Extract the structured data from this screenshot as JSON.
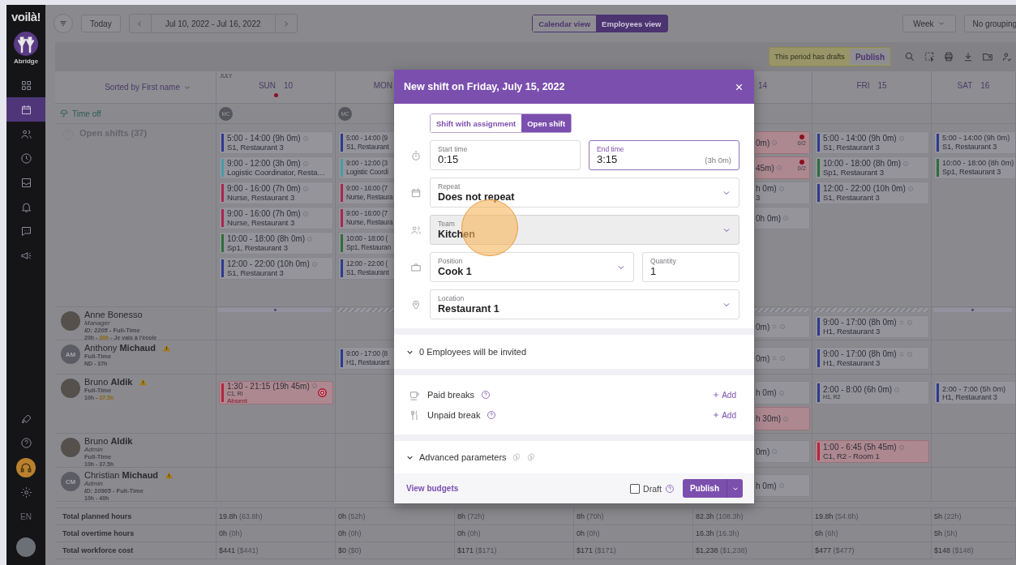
{
  "sidebar": {
    "logo": "voilà!",
    "org": "Abridge",
    "nav": [
      {
        "selected": false
      },
      {
        "selected": true
      },
      {
        "selected": false
      },
      {
        "selected": false
      },
      {
        "selected": false
      },
      {
        "selected": false
      },
      {
        "selected": false
      },
      {
        "selected": false
      }
    ],
    "language": "EN"
  },
  "topbar": {
    "today": "Today",
    "date_range": "Jul 10, 2022 - Jul 16, 2022",
    "views": [
      {
        "label": "Calendar view",
        "selected": false
      },
      {
        "label": "Employees view",
        "selected": true
      }
    ],
    "period": "Week",
    "grouping": "No grouping"
  },
  "toolbar": {
    "drafts_notice": "This period has drafts",
    "publish": "Publish"
  },
  "calendar": {
    "sort": "Sorted by First name",
    "month": "JULY",
    "days": [
      {
        "name": "SUN",
        "date": "10",
        "marker": true
      },
      {
        "name": "MON",
        "marker": false
      },
      {
        "date": "14",
        "marker": false
      },
      {
        "name": "FRI",
        "date": "15",
        "marker": false
      },
      {
        "name": "SAT",
        "date": "16",
        "marker": false
      }
    ]
  },
  "time_off": {
    "label": "Time off",
    "cells": [
      {
        "initials": "MC"
      },
      {
        "initials": "MC"
      },
      {},
      {},
      {},
      {},
      {}
    ]
  },
  "open_shifts": {
    "label": "Open shifts (37)",
    "cells": [
      {
        "cards": [
          {
            "time": "5:00 - 14:00 (9h 0m)",
            "place": "S1, Restaurant 3",
            "color": "#2f3a8c",
            "warning": false
          },
          {
            "time": "9:00 - 12:00 (3h 0m)",
            "place": "Logistic Coordinator, Resta…",
            "color": "#4a9aa6",
            "warning": false
          },
          {
            "time": "9:00 - 16:00 (7h 0m)",
            "place": "Nurse, Restaurant 3",
            "color": "#a8284f",
            "warning": false
          },
          {
            "time": "9:00 - 16:00 (7h 0m)",
            "place": "Nurse, Restaurant 3",
            "color": "#a8284f",
            "warning": false
          },
          {
            "time": "10:00 - 18:00 (8h 0m)",
            "place": "Sp1, Restaurant 3",
            "color": "#2f6e3a",
            "warning": false
          },
          {
            "time": "12:00 - 22:00 (10h 0m)",
            "place": "S1, Restaurant 3",
            "color": "#2f3a8c",
            "warning": false
          }
        ]
      },
      {
        "cards": [
          {
            "time": "5:00 - 14:00 (9",
            "place": "S1, Restaurant",
            "color": "#2f3a8c",
            "warning": false
          },
          {
            "time": "9:00 - 12:00 (3",
            "place": "Logistic Coordi",
            "color": "#4a9aa6",
            "warning": false
          },
          {
            "time": "9:00 - 16:00 (7",
            "place": "Nurse, Restaura",
            "color": "#a8284f",
            "warning": false
          },
          {
            "time": "9:00 - 16:00 (7",
            "place": "Nurse, Restaura",
            "color": "#a8284f",
            "warning": false
          },
          {
            "time": "10:00 - 18:00 (",
            "place": "Sp1, Restauran",
            "color": "#2f6e3a",
            "warning": false
          },
          {
            "time": "12:00 - 22:00 (",
            "place": "S1, Restaurant",
            "color": "#2f3a8c",
            "warning": false
          }
        ]
      },
      {},
      {},
      {
        "cards": [
          {
            "time": "0m)",
            "fill": "0/2",
            "warning": true
          },
          {
            "time": "45m)",
            "fill": "0/2",
            "warning": true
          },
          {
            "time": "h 0m)",
            "place": "3",
            "warning": false
          },
          {
            "time": "0h 0m)",
            "warning": false
          }
        ]
      },
      {
        "cards": [
          {
            "time": "5:00 - 14:00 (9h 0m)",
            "place": "S1, Restaurant 3",
            "color": "#2f3a8c",
            "warning": false
          },
          {
            "time": "10:00 - 18:00 (8h 0m)",
            "place": "Sp1, Restaurant 3",
            "color": "#2f6e3a",
            "warning": false
          },
          {
            "time": "12:00 - 22:00 (10h 0m)",
            "place": "S1, Restaurant 3",
            "color": "#2f3a8c",
            "warning": false
          }
        ]
      },
      {
        "cards": [
          {
            "time": "5:00 - 14:00 (9h 0m)",
            "place": "S1, Restaurant 3",
            "color": "#2f3a8c",
            "warning": false
          },
          {
            "time": "10:00 - 18:00 (8h 0m)",
            "place": "Sp1, Restaurant 3",
            "color": "#2f6e3a",
            "warning": false
          }
        ]
      }
    ]
  },
  "employees": [
    {
      "name": "Anne Bonesso",
      "avatar": {
        "kind": "photo"
      },
      "warning": false,
      "role": "Manager",
      "contract": "*ID: 2205* - Full-Time",
      "hours": [
        {
          "text": "20h - ",
          "over": false
        },
        {
          "text": "30h",
          "over": true
        },
        {
          "text": " - Je vais à l'école",
          "over": false
        }
      ],
      "cells": [
        {
          "strip": {
            "kind": "heart"
          }
        },
        {
          "strip": {
            "kind": "hatched"
          }
        },
        {},
        {},
        {
          "strip": {
            "kind": "hatched"
          },
          "cards": [
            {
              "time": "0m)",
              "warning": false,
              "swap": true
            }
          ]
        },
        {
          "strip": {
            "kind": "hatched"
          },
          "cards": [
            {
              "time": "9:00 - 17:00 (8h 0m)",
              "place": "H1, Restaurant 3",
              "color": "#2f3a8c",
              "warning": false,
              "swap": true
            }
          ]
        },
        {
          "strip": {
            "kind": "heart"
          }
        }
      ]
    },
    {
      "name": "Anthony **Michaud**",
      "avatar": {
        "kind": "initials",
        "initials": "AM"
      },
      "warning": true,
      "contract": "Full-Time",
      "hours": [
        {
          "text": "ND - 37h",
          "over": false
        }
      ],
      "cells": [
        {},
        {
          "cards": [
            {
              "time": "9:00 - 17:00 (8",
              "place": "H1, Restaurant",
              "color": "#2f3a8c",
              "warning": false
            }
          ]
        },
        {},
        {},
        {
          "cards": [
            {
              "time": "0m)",
              "warning": false,
              "swap": true
            }
          ]
        },
        {
          "cards": [
            {
              "time": "9:00 - 17:00 (8h 0m)",
              "place": "H1, Restaurant 3",
              "color": "#2f3a8c",
              "warning": false,
              "swap": true
            }
          ]
        },
        {}
      ]
    },
    {
      "name": "Bruno **Aldik**",
      "avatar": {
        "kind": "photo"
      },
      "warning": true,
      "contract": "Full-Time",
      "hours": [
        {
          "text": "10h - ",
          "over": false
        },
        {
          "text": "37.5h",
          "over": true
        }
      ],
      "cells": [
        {
          "cards": [
            {
              "time": "1:30 - 21:15 (19h 45m)",
              "place": "C1, RI",
              "note": "Absent",
              "color": "#b3263f",
              "warning": true
            }
          ]
        },
        {},
        {},
        {},
        {
          "cards": [
            {
              "time": "h 0m)",
              "warning": false
            },
            {
              "time": "h 30m)",
              "warning": true
            }
          ]
        },
        {
          "cards": [
            {
              "time": "2:00 - 8:00 (6h 0m)",
              "place": "H1, R2",
              "color": "#2f3a8c",
              "warning": false
            }
          ]
        },
        {
          "cards": [
            {
              "time": "2:00 - 7:00 (5h 0m)",
              "place": "H1, Restaurant 3",
              "color": "#2f3a8c",
              "warning": false
            }
          ]
        }
      ]
    },
    {
      "name": "Bruno **Aldik**",
      "avatar": {
        "kind": "photo"
      },
      "warning": false,
      "role": "Admin",
      "contract": "Full-Time",
      "hours": [
        {
          "text": "10h - 37.5h",
          "over": false
        }
      ],
      "cells": [
        {},
        {},
        {},
        {},
        {
          "cards": [
            {
              "time": "0m)",
              "warning": false
            }
          ]
        },
        {
          "cards": [
            {
              "time": "1:00 - 6:45 (5h 45m)",
              "place": "C1, R2 - Room 1",
              "color": "#b3263f",
              "warning": true
            }
          ]
        },
        {}
      ]
    },
    {
      "name": "Christian **Michaud**",
      "avatar": {
        "kind": "initials",
        "initials": "CM"
      },
      "warning": true,
      "role": "Admin",
      "contract": "*ID: 10905* - Full-Time",
      "hours": [
        {
          "text": "10h - 40h",
          "over": false
        }
      ],
      "cells": [
        {},
        {},
        {},
        {},
        {
          "cards": [
            {
              "time": "h 0m)",
              "warning": false
            }
          ]
        },
        {},
        {}
      ]
    }
  ],
  "totals": [
    {
      "label": "Total planned hours",
      "values": [
        {
          "value": "19.8h",
          "total": "(63.8h)"
        },
        {
          "value": "0h",
          "total": "(52h)"
        },
        {
          "value": "8h",
          "total": "(72h)"
        },
        {
          "value": "8h",
          "total": "(70h)"
        },
        {
          "value": "82.3h",
          "total": "(108.3h)"
        },
        {
          "value": "19.8h",
          "total": "(54.8h)"
        },
        {
          "value": "5h",
          "total": "(22h)"
        }
      ]
    },
    {
      "label": "Total overtime hours",
      "values": [
        {
          "value": "0h",
          "total": "(0h)"
        },
        {
          "value": "0h",
          "total": "(0h)"
        },
        {
          "value": "0h",
          "total": "(0h)"
        },
        {
          "value": "0h",
          "total": "(0h)"
        },
        {
          "value": "16.3h",
          "total": "(16.3h)"
        },
        {
          "value": "6h",
          "total": "(6h)"
        },
        {
          "value": "5h",
          "total": "(5h)"
        }
      ]
    },
    {
      "label": "Total workforce cost",
      "values": [
        {
          "value": "$441",
          "total": "($441)"
        },
        {
          "value": "$0",
          "total": "($0)"
        },
        {
          "value": "$171",
          "total": "($171)"
        },
        {
          "value": "$171",
          "total": "($171)"
        },
        {
          "value": "$1,238",
          "total": "($1,238)"
        },
        {
          "value": "$477",
          "total": "($477)"
        },
        {
          "value": "$148",
          "total": "($148)"
        }
      ]
    }
  ],
  "modal": {
    "title": "New shift on Friday, July 15, 2022",
    "modes": [
      {
        "label": "Shift with assignment",
        "selected": false
      },
      {
        "label": "Open shift",
        "selected": true
      }
    ],
    "start": {
      "label": "Start time",
      "value": "0:15",
      "focused": false
    },
    "end": {
      "label": "End time",
      "value": "3:15",
      "duration": "(3h 0m)",
      "focused": true
    },
    "repeat": {
      "label": "Repeat",
      "value": "Does not repeat",
      "disabled": false
    },
    "team": {
      "label": "Team",
      "value": "Kitchen",
      "disabled": true
    },
    "position": {
      "label": "Position",
      "value": "Cook 1",
      "disabled": false
    },
    "quantity": {
      "label": "Quantity",
      "value": "1"
    },
    "location": {
      "label": "Location",
      "value": "Restaurant 1",
      "disabled": false
    },
    "invited": "0 Employees will be invited",
    "breaks": [
      {
        "label": "Paid breaks",
        "action": "Add"
      },
      {
        "label": "Unpaid break",
        "action": "Add"
      }
    ],
    "advanced": "Advanced parameters",
    "footer": {
      "link": "View budgets",
      "draft": {
        "label": "Draft",
        "checked": false
      },
      "publish": "Publish"
    }
  }
}
